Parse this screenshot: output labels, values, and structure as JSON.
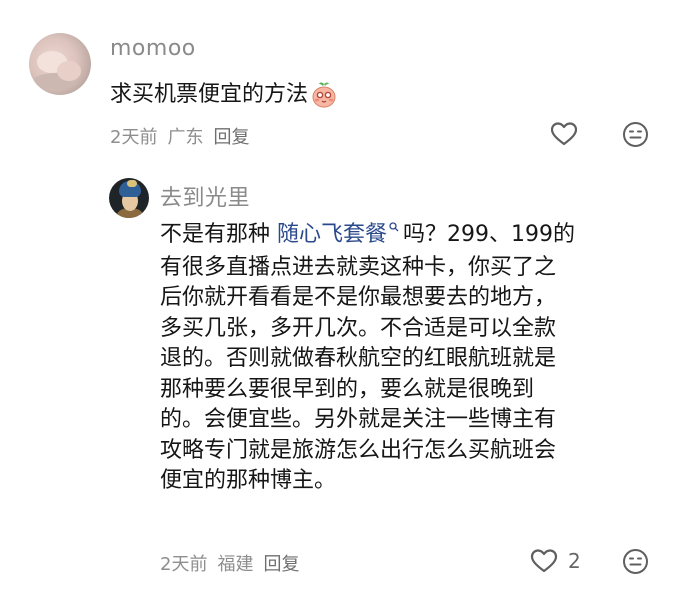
{
  "comment": {
    "username": "momoo",
    "text": "求买机票便宜的方法",
    "emoji_icon": "blushing-peach-emoji-icon",
    "time": "2天前",
    "location": "广东",
    "reply_label": "回复",
    "like_icon": "heart-icon",
    "dislike_icon": "neutral-face-icon"
  },
  "reply": {
    "username": "去到光里",
    "prefix": "不是有那种 ",
    "link_text": "随心飞套餐",
    "link_icon": "search-icon",
    "line1_rest": "吗？299、199的",
    "lines": [
      "有很多直播点进去就卖这种卡，你买了之",
      "后你就开看看是不是你最想要去的地方，",
      "多买几张，多开几次。不合适是可以全款",
      "退的。否则就做春秋航空的红眼航班就是",
      "那种要么要很早到的，要么就是很晚到",
      "的。会便宜些。另外就是关注一些博主有",
      "攻略专门就是旅游怎么出行怎么买航班会",
      "便宜的那种博主。"
    ],
    "time": "2天前",
    "location": "福建",
    "reply_label": "回复",
    "like_count": "2",
    "like_icon": "heart-icon",
    "dislike_icon": "neutral-face-icon"
  }
}
